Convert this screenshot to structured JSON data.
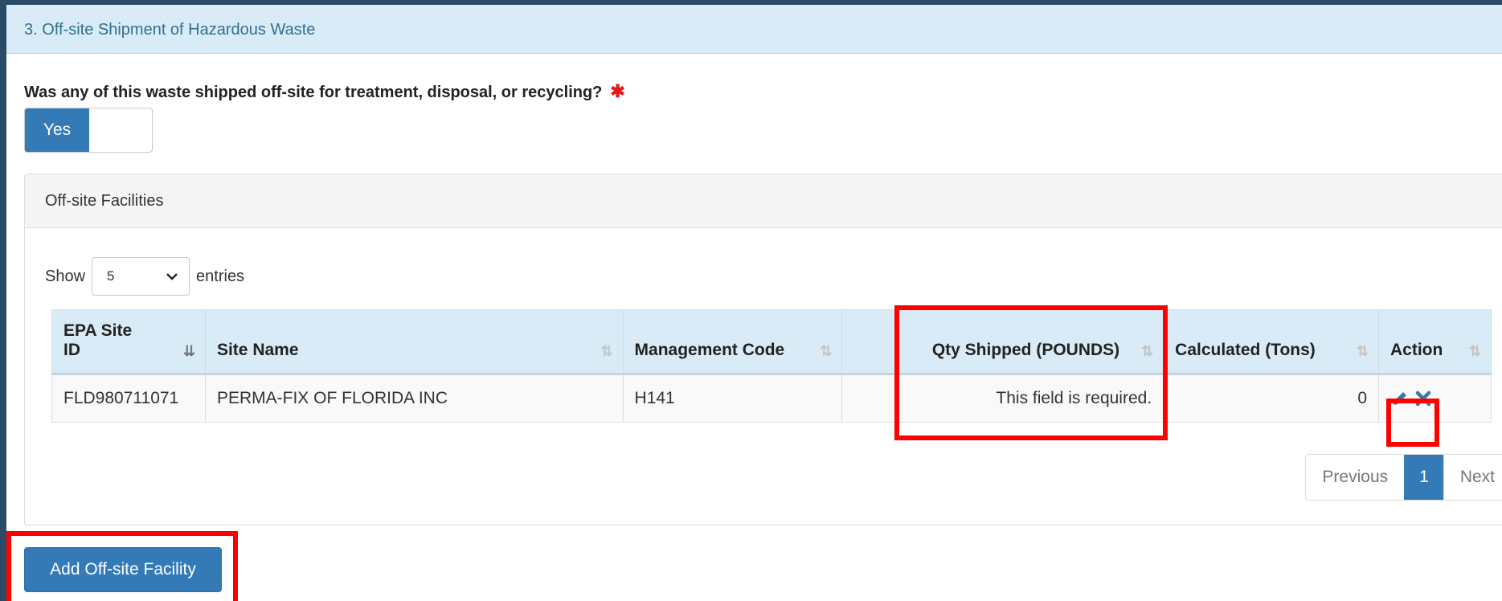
{
  "section": {
    "title": "3. Off-site Shipment of Hazardous Waste"
  },
  "question": {
    "text": "Was any of this waste shipped off-site for treatment, disposal, or recycling?",
    "required_marker": "✱",
    "toggle_value": "Yes"
  },
  "facilities": {
    "title": "Off-site Facilities",
    "show_label": "Show",
    "entries_label": "entries",
    "page_size": "5",
    "columns": [
      "EPA Site ID",
      "Site Name",
      "Management Code",
      "Qty Shipped (POUNDS)",
      "Calculated (Tons)",
      "Action"
    ],
    "rows": [
      {
        "epa_site_id": "FLD980711071",
        "site_name": "PERMA-FIX OF FLORIDA INC",
        "management_code": "H141",
        "qty_shipped": "This field is required.",
        "calculated_tons": "0"
      }
    ],
    "pagination": {
      "previous": "Previous",
      "current": "1",
      "next": "Next"
    }
  },
  "add_button": "Add Off-site Facility",
  "colors": {
    "primary": "#337ab7",
    "error": "#d0021b",
    "highlight": "#ff0000",
    "header_bg": "#d9ebf6"
  },
  "icons": {
    "sort": "sort-icon",
    "sort_active": "sort-ascending-icon",
    "edit": "pencil-icon",
    "delete": "close-icon",
    "select": "chevron-down-icon"
  }
}
